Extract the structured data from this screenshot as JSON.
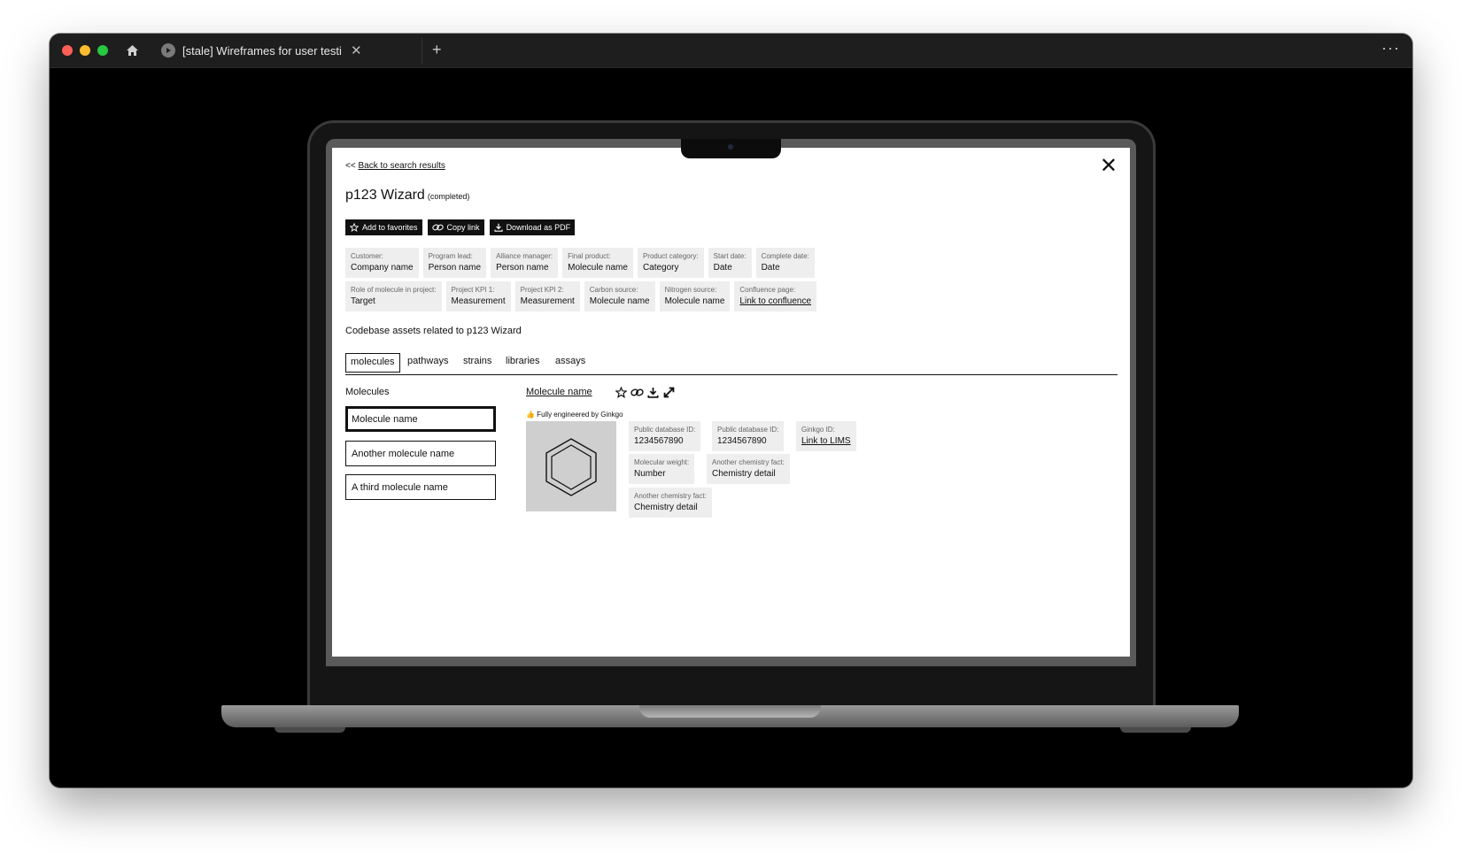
{
  "browser": {
    "tab_title": "[stale] Wireframes for user testing",
    "close_tab_glyph": "✕",
    "new_tab_glyph": "+",
    "more_glyph": "···",
    "traffic_colors": {
      "red": "#ff5f57",
      "yellow": "#febc2e",
      "green": "#28c840"
    }
  },
  "page": {
    "back_prefix": "<<",
    "back_link": "Back to search results",
    "close_glyph": "✕",
    "title": "p123 Wizard",
    "status": "(completed)",
    "buttons": {
      "favorites": "Add to favorites",
      "copy_link": "Copy link",
      "download": "Download as PDF"
    },
    "meta_row1": [
      {
        "label": "Customer:",
        "value": "Company name"
      },
      {
        "label": "Program lead:",
        "value": "Person name"
      },
      {
        "label": "Alliance manager:",
        "value": "Person name"
      },
      {
        "label": "Final product:",
        "value": "Molecule name"
      },
      {
        "label": "Product category:",
        "value": "Category"
      },
      {
        "label": "Start date:",
        "value": "Date"
      },
      {
        "label": "Complete date:",
        "value": "Date"
      }
    ],
    "meta_row2": [
      {
        "label": "Role of molecule in project:",
        "value": "Target"
      },
      {
        "label": "Project KPI 1:",
        "value": "Measurement"
      },
      {
        "label": "Project KPI 2:",
        "value": "Measurement"
      },
      {
        "label": "Carbon source:",
        "value": "Molecule name"
      },
      {
        "label": "Nitrogen source:",
        "value": "Molecule name"
      },
      {
        "label": "Confluence page:",
        "value": "Link to confluence"
      }
    ],
    "assets_title": "Codebase assets related to p123 Wizard",
    "tabs": [
      "molecules",
      "pathways",
      "strains",
      "libraries",
      "assays"
    ],
    "molecules_heading": "Molecules",
    "molecules": [
      "Molecule name",
      "Another molecule name",
      "A third molecule name"
    ],
    "detail": {
      "name": "Molecule name",
      "badge": "👍 Fully engineered by Ginkgo",
      "facts": [
        {
          "label": "Public database ID:",
          "value": "1234567890"
        },
        {
          "label": "Public database ID:",
          "value": "1234567890"
        },
        {
          "label": "Ginkgo ID:",
          "value": "Link to LIMS"
        },
        {
          "label": "Molecular weight:",
          "value": "Number"
        },
        {
          "label": "Another chemistry fact:",
          "value": "Chemistry detail"
        },
        {
          "label": "Another chemistry fact:",
          "value": "Chemistry detail"
        }
      ]
    }
  }
}
